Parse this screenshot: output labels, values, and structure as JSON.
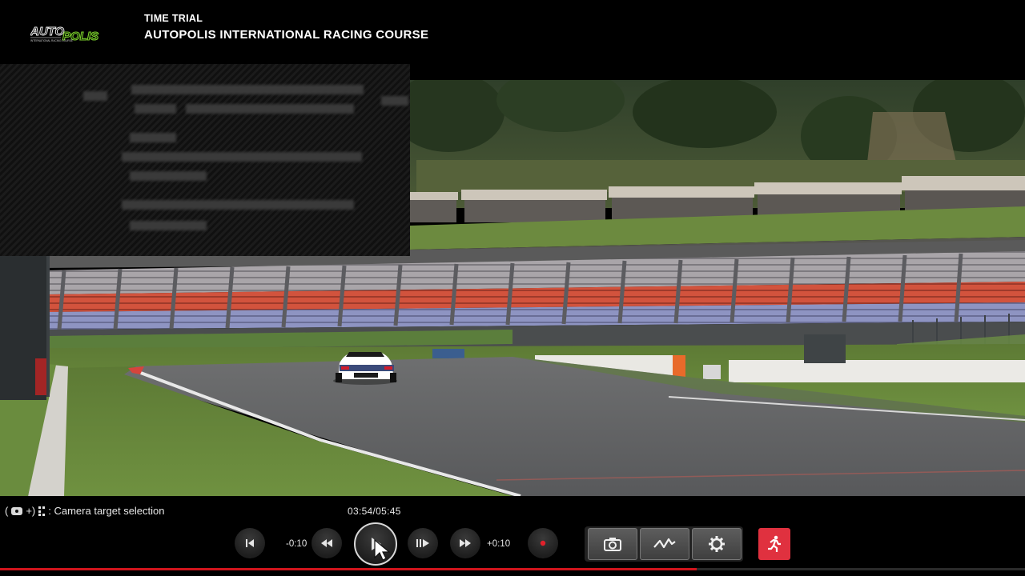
{
  "header": {
    "logo_text": "AUTOPOLIS",
    "logo_subtext": "INTERNATIONAL RACING COURSE",
    "mode": "TIME TRIAL",
    "course": "AUTOPOLIS INTERNATIONAL RACING COURSE"
  },
  "hint": {
    "open_paren": "(",
    "plus_paren": "+)",
    "label": ": Camera target selection"
  },
  "playback": {
    "time": "03:54/05:45",
    "rewind_label": "-0:10",
    "forward_label": "+0:10",
    "progress": 0.6797
  },
  "buttons": {
    "skip_start": "skip-to-start-icon",
    "rewind": "rewind-icon",
    "play": "play-icon",
    "step": "frame-step-icon",
    "fast_forward": "fast-forward-icon",
    "record": "record-icon",
    "photo": "camera-icon",
    "telemetry": "chart-icon",
    "settings": "gear-icon",
    "exit": "exit-icon"
  },
  "colors": {
    "accent_red": "#d0141c",
    "exit_button": "#e0313f",
    "logo_green": "#7bd12b"
  }
}
